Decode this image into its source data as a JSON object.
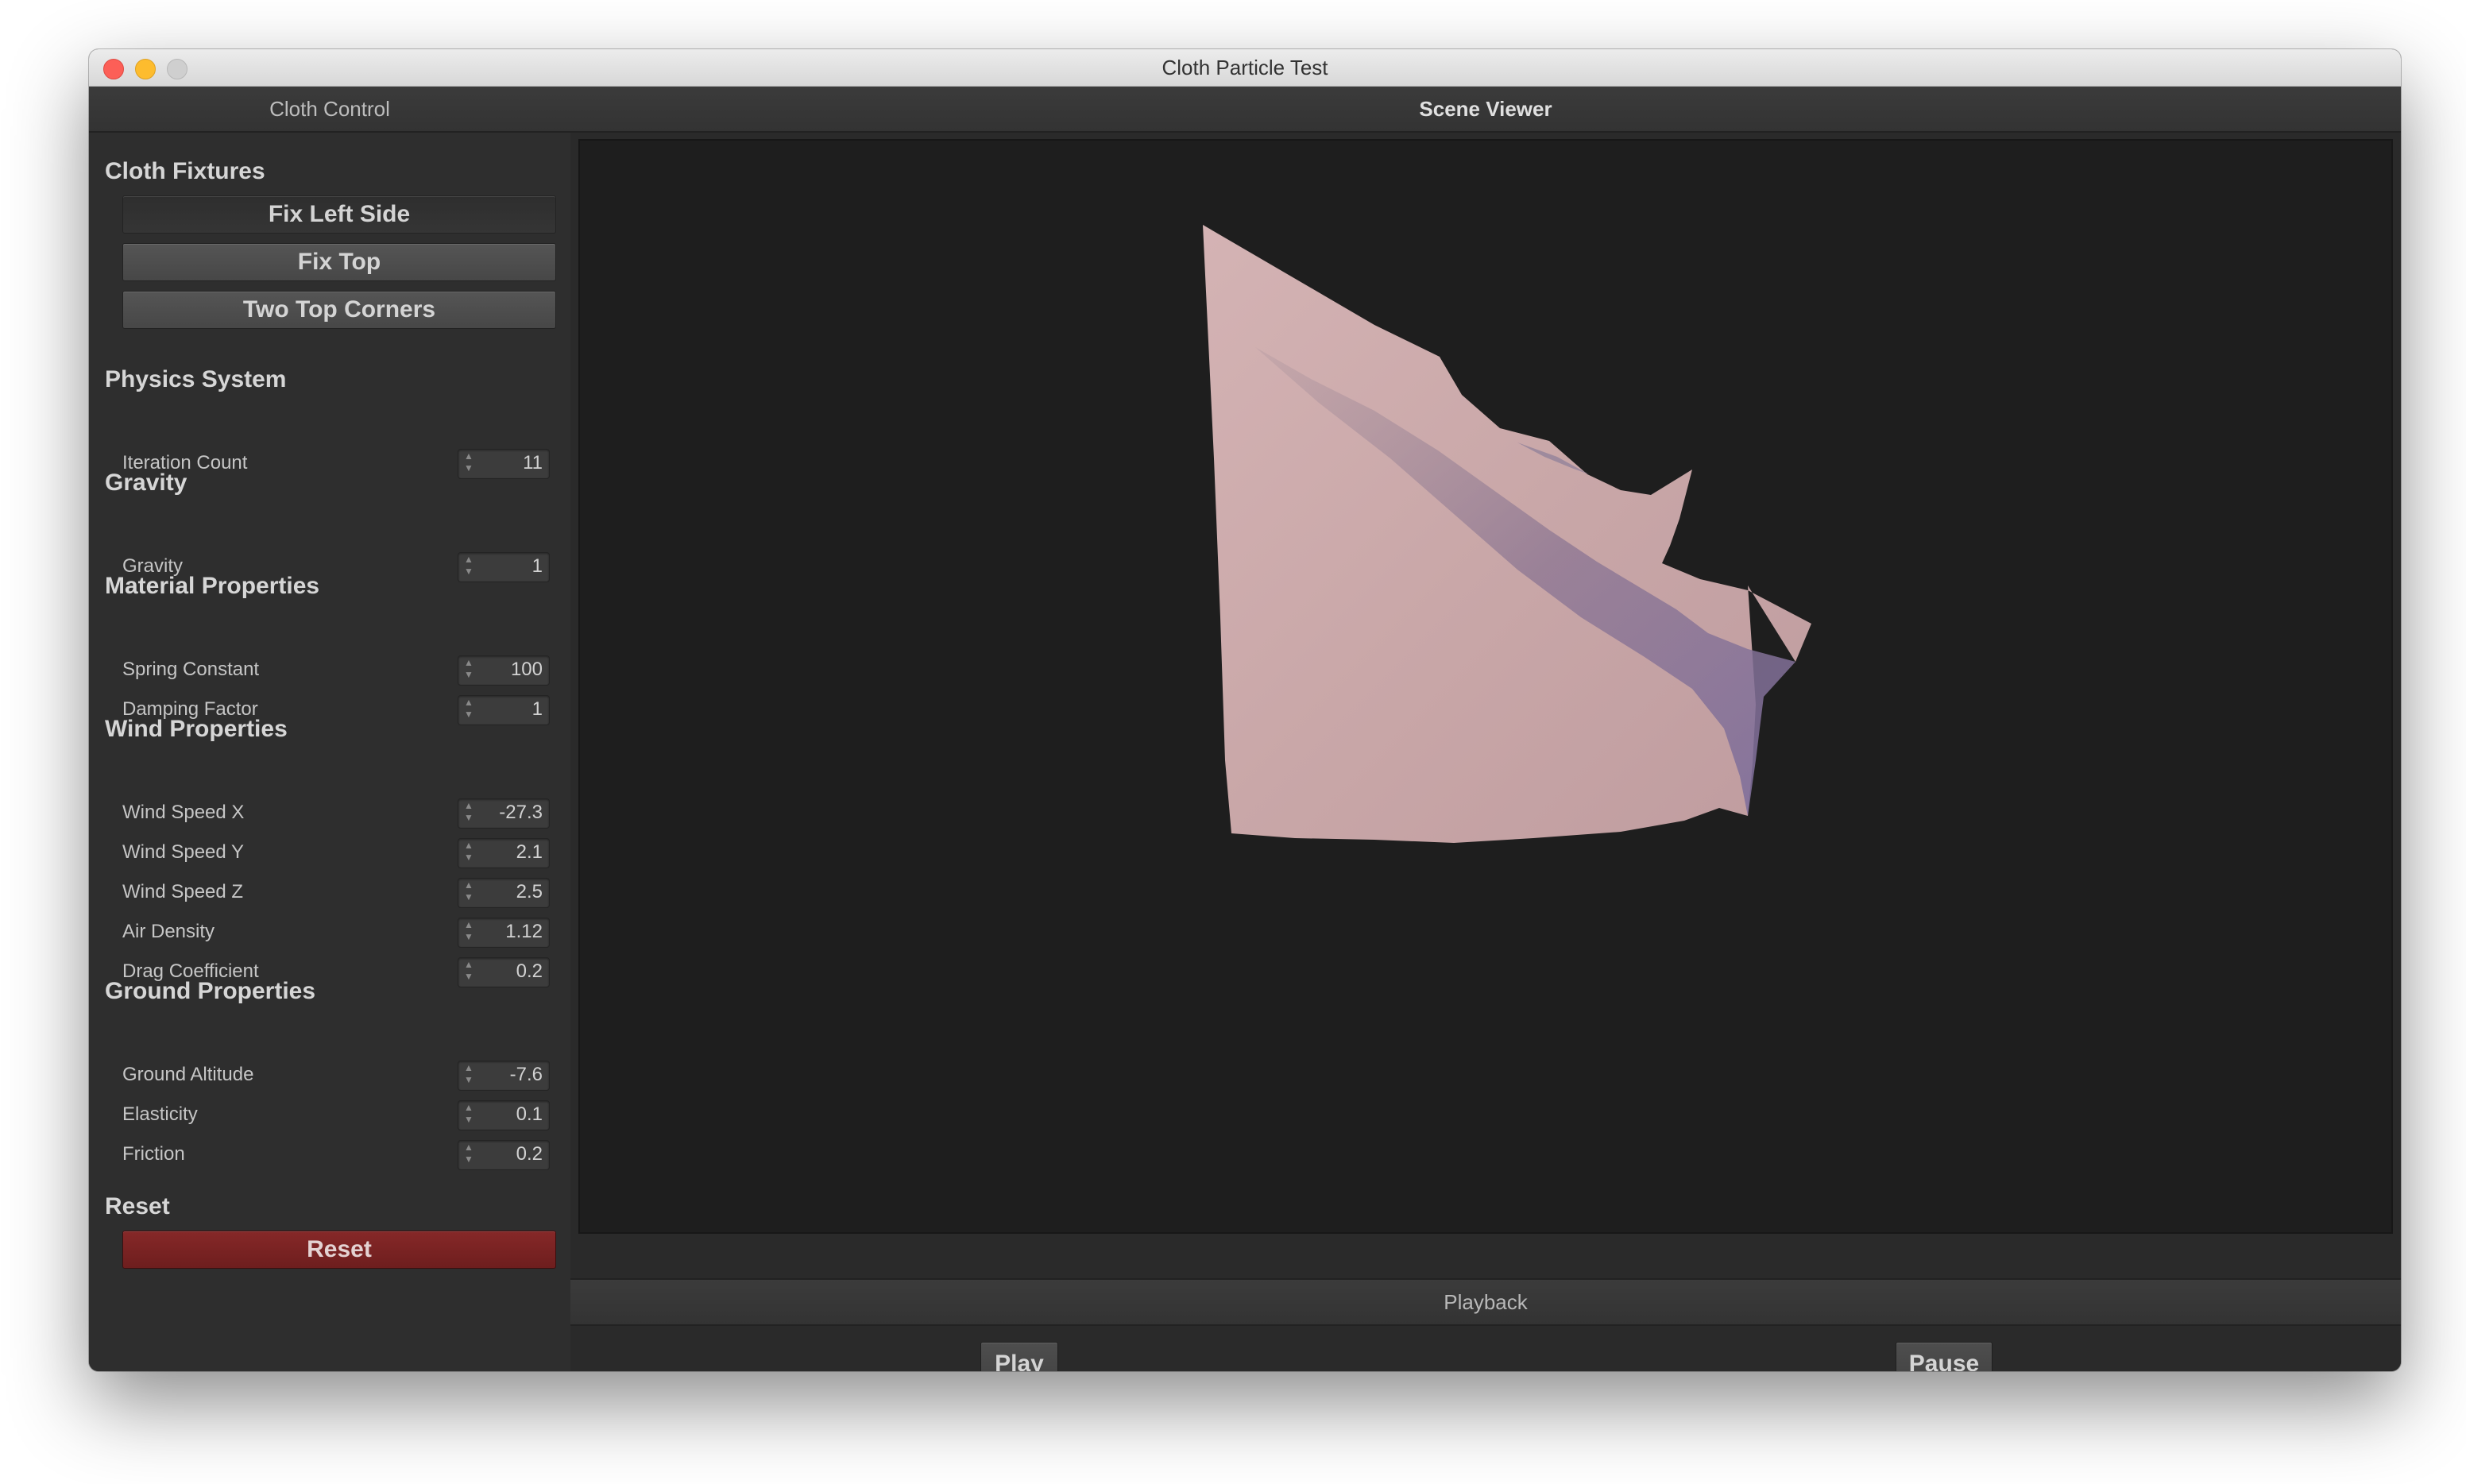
{
  "window": {
    "title": "Cloth Particle Test"
  },
  "sidebar": {
    "header": "Cloth Control",
    "fixtures": {
      "title": "Cloth Fixtures",
      "buttons": [
        "Fix Left Side",
        "Fix Top",
        "Two Top Corners"
      ]
    },
    "physics": {
      "title": "Physics System",
      "fields": [
        {
          "label": "Iteration Count",
          "value": "11"
        }
      ]
    },
    "gravity": {
      "title": "Gravity",
      "fields": [
        {
          "label": "Gravity",
          "value": "1"
        }
      ]
    },
    "material": {
      "title": "Material Properties",
      "fields": [
        {
          "label": "Spring Constant",
          "value": "100"
        },
        {
          "label": "Damping Factor",
          "value": "1"
        }
      ]
    },
    "wind": {
      "title": "Wind Properties",
      "fields": [
        {
          "label": "Wind Speed X",
          "value": "-27.3"
        },
        {
          "label": "Wind Speed Y",
          "value": "2.1"
        },
        {
          "label": "Wind Speed Z",
          "value": "2.5"
        },
        {
          "label": "Air Density",
          "value": "1.12"
        },
        {
          "label": "Drag Coefficient",
          "value": "0.2"
        }
      ]
    },
    "ground": {
      "title": "Ground Properties",
      "fields": [
        {
          "label": "Ground Altitude",
          "value": "-7.6"
        },
        {
          "label": "Elasticity",
          "value": "0.1"
        },
        {
          "label": "Friction",
          "value": "0.2"
        }
      ]
    },
    "reset": {
      "title": "Reset",
      "button": "Reset"
    }
  },
  "main": {
    "header": "Scene Viewer",
    "playback": {
      "header": "Playback",
      "play": "Play",
      "pause": "Pause"
    }
  },
  "colors": {
    "cloth": "#c9a7a8",
    "cloth_shadow": "#8f7d96",
    "reset_button": "#7a2323"
  }
}
